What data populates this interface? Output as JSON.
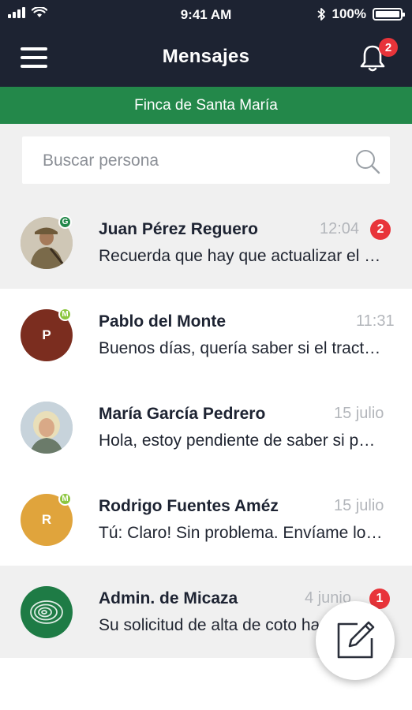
{
  "status_bar": {
    "time": "9:41 AM",
    "battery": "100%"
  },
  "header": {
    "title": "Mensajes",
    "notification_count": "2"
  },
  "farm": {
    "name": "Finca de Santa María"
  },
  "search": {
    "placeholder": "Buscar persona"
  },
  "conversations": [
    {
      "name": "Juan Pérez Reguero",
      "time": "12:04",
      "preview": "Recuerda que hay que actualizar el parte de incidencias",
      "unread": "2",
      "role": "G",
      "role_color": "#23884a",
      "avatar_type": "photo"
    },
    {
      "name": "Pablo del Monte",
      "time": "11:31",
      "preview": "Buenos días, quería saber si el tractor está disponible",
      "initial": "P",
      "avatar_color": "#7b2d1f",
      "role": "M",
      "role_color": "#8cc63f"
    },
    {
      "name": "María García Pedrero",
      "time": "15 julio",
      "preview": "Hola, estoy pendiente de saber si podemos vernos",
      "avatar_type": "photo"
    },
    {
      "name": "Rodrigo Fuentes Améz",
      "time": "15 julio",
      "preview": "Tú: Claro! Sin problema. Envíame los datos",
      "initial": "R",
      "avatar_color": "#e0a43c",
      "role": "M",
      "role_color": "#8cc63f"
    },
    {
      "name": "Admin. de Micaza",
      "time": "4 junio",
      "preview": "Su solicitud de alta de coto ha sido aprobada",
      "unread": "1",
      "avatar_color": "#1e7b45",
      "avatar_type": "logo"
    }
  ],
  "colors": {
    "header_bg": "#1d2332",
    "farm_bar": "#23884a",
    "badge_red": "#e8343a"
  },
  "icons": [
    "menu-icon",
    "bell-icon",
    "search-icon",
    "compose-icon"
  ]
}
